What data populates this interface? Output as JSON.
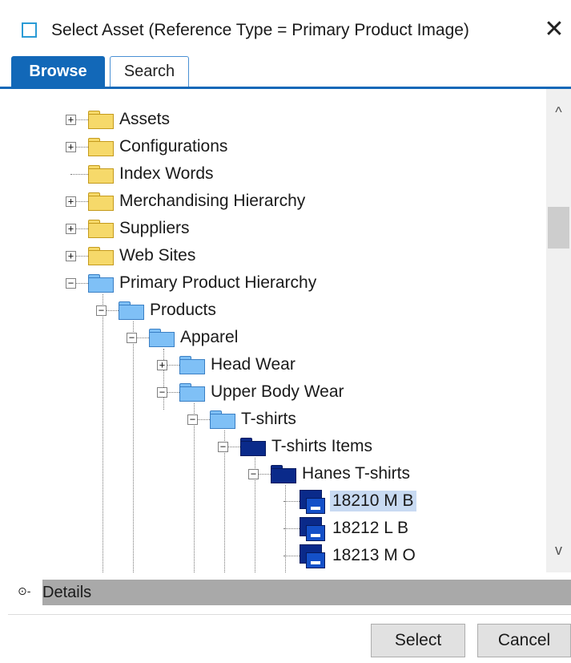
{
  "window": {
    "title": "Select Asset (Reference Type = Primary Product Image)",
    "close_symbol": "✕",
    "app_icon": "window-icon",
    "accent_color": "#1268b8"
  },
  "tabs": [
    {
      "label": "Browse",
      "active": true
    },
    {
      "label": "Search",
      "active": false
    }
  ],
  "tree": {
    "expand_symbol": "+",
    "collapse_symbol": "−",
    "nodes": [
      {
        "label": "Assets",
        "icon": "yellow-folder-icon",
        "expander": "plus"
      },
      {
        "label": "Configurations",
        "icon": "yellow-folder-icon",
        "expander": "plus"
      },
      {
        "label": "Index Words",
        "icon": "yellow-folder-icon",
        "expander": "none"
      },
      {
        "label": "Merchandising Hierarchy",
        "icon": "yellow-folder-icon",
        "expander": "plus"
      },
      {
        "label": "Suppliers",
        "icon": "yellow-folder-icon",
        "expander": "plus"
      },
      {
        "label": "Web Sites",
        "icon": "yellow-folder-icon",
        "expander": "plus"
      },
      {
        "label": "Primary Product Hierarchy",
        "icon": "blue-folder-icon",
        "expander": "minus"
      },
      {
        "label": "Products",
        "icon": "blue-folder-icon",
        "expander": "minus"
      },
      {
        "label": "Apparel",
        "icon": "blue-folder-icon",
        "expander": "minus"
      },
      {
        "label": "Head Wear",
        "icon": "blue-folder-icon",
        "expander": "plus"
      },
      {
        "label": "Upper Body Wear",
        "icon": "blue-folder-icon",
        "expander": "minus"
      },
      {
        "label": "T-shirts",
        "icon": "blue-folder-icon",
        "expander": "minus"
      },
      {
        "label": "T-shirts Items",
        "icon": "navy-folder-icon",
        "expander": "minus"
      },
      {
        "label": "Hanes T-shirts",
        "icon": "navy-folder-icon",
        "expander": "minus"
      },
      {
        "label": "18210 M B",
        "icon": "product-icon",
        "expander": "none",
        "selected": true
      },
      {
        "label": "18212 L B",
        "icon": "product-icon",
        "expander": "none"
      },
      {
        "label": "18213 M O",
        "icon": "product-icon",
        "expander": "none"
      }
    ]
  },
  "scrollbar": {
    "up_symbol": "^",
    "down_symbol": "v"
  },
  "details": {
    "label": "Details",
    "toggle_symbol": "⊙-"
  },
  "buttons": {
    "select": "Select",
    "cancel": "Cancel"
  }
}
